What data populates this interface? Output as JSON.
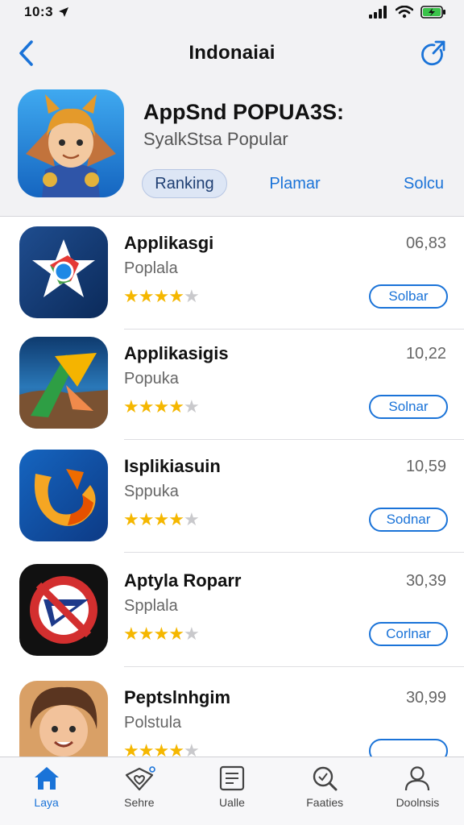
{
  "status": {
    "time": "10:3"
  },
  "nav": {
    "title": "Indonaiai"
  },
  "header": {
    "title": "AppSnd POPUA3S:",
    "subtitle": "SyalkStsa Popular",
    "segments": [
      "Ranking",
      "Plamar",
      "Solcu"
    ]
  },
  "apps": [
    {
      "name": "Applikasgi",
      "subtitle": "Poplala",
      "rating": 4,
      "size": "06,83",
      "button": "Solbar"
    },
    {
      "name": "Applikasigis",
      "subtitle": "Popuka",
      "rating": 4,
      "size": "10,22",
      "button": "Solnar"
    },
    {
      "name": "Isplikiasuin",
      "subtitle": "Sppuka",
      "rating": 4,
      "size": "10,59",
      "button": "Sodnar"
    },
    {
      "name": "Aptyla Roparr",
      "subtitle": "Spplala",
      "rating": 4,
      "size": "30,39",
      "button": "Corlnar"
    },
    {
      "name": "Peptslnhgim",
      "subtitle": "Polstula",
      "rating": 4,
      "size": "30,99",
      "button": ""
    }
  ],
  "tabs": [
    {
      "label": "Laya",
      "icon": "home-icon"
    },
    {
      "label": "Sehre",
      "icon": "heart-message-icon"
    },
    {
      "label": "Ualle",
      "icon": "document-icon"
    },
    {
      "label": "Faaties",
      "icon": "search-icon"
    },
    {
      "label": "Doolnsis",
      "icon": "person-icon"
    }
  ],
  "colors": {
    "accent": "#1a73d8",
    "star": "#f5b700"
  }
}
